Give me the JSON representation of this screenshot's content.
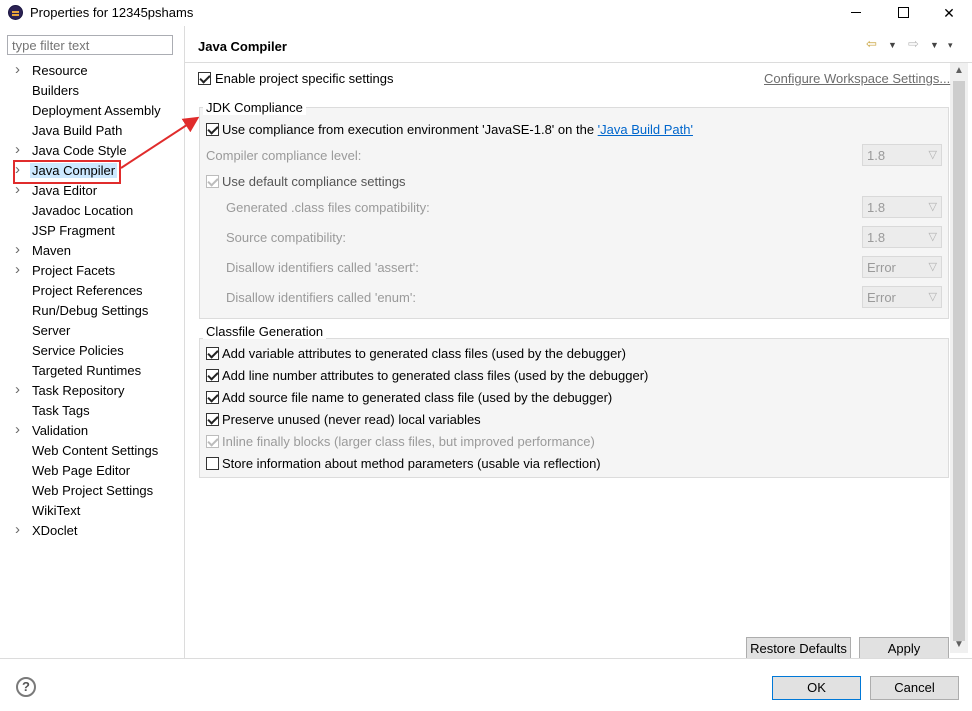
{
  "window": {
    "title": "Properties for 12345pshams"
  },
  "filter": {
    "placeholder": "type filter text"
  },
  "tree": [
    {
      "label": "Resource",
      "expandable": true
    },
    {
      "label": "Builders",
      "expandable": false
    },
    {
      "label": "Deployment Assembly",
      "expandable": false
    },
    {
      "label": "Java Build Path",
      "expandable": false
    },
    {
      "label": "Java Code Style",
      "expandable": true
    },
    {
      "label": "Java Compiler",
      "expandable": true,
      "selected": true
    },
    {
      "label": "Java Editor",
      "expandable": true
    },
    {
      "label": "Javadoc Location",
      "expandable": false
    },
    {
      "label": "JSP Fragment",
      "expandable": false
    },
    {
      "label": "Maven",
      "expandable": true
    },
    {
      "label": "Project Facets",
      "expandable": true
    },
    {
      "label": "Project References",
      "expandable": false
    },
    {
      "label": "Run/Debug Settings",
      "expandable": false
    },
    {
      "label": "Server",
      "expandable": false
    },
    {
      "label": "Service Policies",
      "expandable": false
    },
    {
      "label": "Targeted Runtimes",
      "expandable": false
    },
    {
      "label": "Task Repository",
      "expandable": true
    },
    {
      "label": "Task Tags",
      "expandable": false
    },
    {
      "label": "Validation",
      "expandable": true
    },
    {
      "label": "Web Content Settings",
      "expandable": false
    },
    {
      "label": "Web Page Editor",
      "expandable": false
    },
    {
      "label": "Web Project Settings",
      "expandable": false
    },
    {
      "label": "WikiText",
      "expandable": false
    },
    {
      "label": "XDoclet",
      "expandable": true
    }
  ],
  "main": {
    "title": "Java Compiler",
    "enable_project_specific": "Enable project specific settings",
    "configure_workspace_link": "Configure Workspace Settings...",
    "jdk": {
      "group_label": "JDK Compliance",
      "use_compliance_prefix": "Use compliance from execution environment 'JavaSE-1.8' on the ",
      "use_compliance_link": "'Java Build Path'",
      "compliance_level_label": "Compiler compliance level:",
      "compliance_level_value": "1.8",
      "use_default_label": "Use default compliance settings",
      "generated_label": "Generated .class files compatibility:",
      "generated_value": "1.8",
      "source_label": "Source compatibility:",
      "source_value": "1.8",
      "assert_label": "Disallow identifiers called 'assert':",
      "assert_value": "Error",
      "enum_label": "Disallow identifiers called 'enum':",
      "enum_value": "Error"
    },
    "classfile": {
      "group_label": "Classfile Generation",
      "options": [
        {
          "label": "Add variable attributes to generated class files (used by the debugger)",
          "checked": true,
          "disabled": false
        },
        {
          "label": "Add line number attributes to generated class files (used by the debugger)",
          "checked": true,
          "disabled": false
        },
        {
          "label": "Add source file name to generated class file (used by the debugger)",
          "checked": true,
          "disabled": false
        },
        {
          "label": "Preserve unused (never read) local variables",
          "checked": true,
          "disabled": false
        },
        {
          "label": "Inline finally blocks (larger class files, but improved performance)",
          "checked": true,
          "disabled": true
        },
        {
          "label": "Store information about method parameters (usable via reflection)",
          "checked": false,
          "disabled": false
        }
      ]
    },
    "restore_defaults": "Restore Defaults",
    "apply": "Apply"
  },
  "footer": {
    "ok": "OK",
    "cancel": "Cancel",
    "help": "?"
  },
  "colors": {
    "highlight": "#e02c2c",
    "selection": "#cce8ff",
    "link": "#0066cc"
  }
}
